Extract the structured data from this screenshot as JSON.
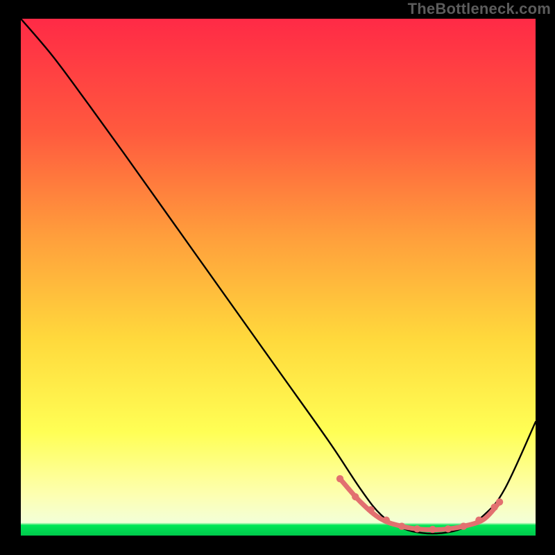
{
  "watermark": "TheBottleneck.com",
  "colors": {
    "background": "#000000",
    "gradient_top": "#ff2a46",
    "gradient_mid_upper": "#ff7a3c",
    "gradient_mid": "#ffc63c",
    "gradient_mid_lower": "#ffff55",
    "gradient_low": "#fdffb0",
    "gradient_bottom": "#00e756",
    "curve": "#000000",
    "highlight": "#e27070"
  },
  "chart_data": {
    "type": "line",
    "title": "",
    "xlabel": "",
    "ylabel": "",
    "xlim": [
      0,
      100
    ],
    "ylim": [
      0,
      100
    ],
    "series": [
      {
        "name": "bottleneck-curve",
        "x": [
          0,
          6,
          12,
          20,
          30,
          40,
          50,
          60,
          66,
          70,
          74,
          78,
          82,
          86,
          90,
          94,
          100
        ],
        "y": [
          100,
          93,
          85,
          74,
          60,
          46,
          32,
          18,
          9,
          4,
          1.5,
          0.5,
          0.5,
          1.5,
          4,
          9,
          22
        ]
      }
    ],
    "highlight_segment": {
      "name": "optimal-range",
      "x": [
        62,
        66,
        70,
        74,
        78,
        82,
        86,
        90,
        93
      ],
      "y": [
        11,
        6.5,
        3.2,
        1.8,
        1.2,
        1.2,
        1.8,
        3.2,
        6.5
      ]
    },
    "highlight_points": {
      "x": [
        62,
        65,
        68,
        71,
        74,
        77,
        80,
        83,
        86,
        89,
        92,
        93
      ],
      "y": [
        11,
        7.5,
        5.0,
        3.0,
        1.8,
        1.3,
        1.2,
        1.3,
        1.8,
        3.0,
        5.5,
        6.5
      ]
    }
  }
}
